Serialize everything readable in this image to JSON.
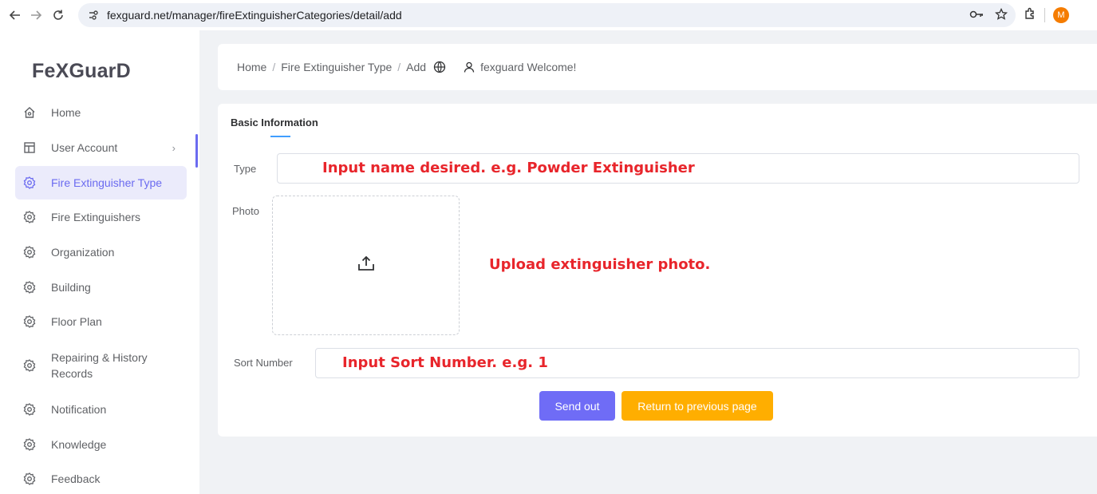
{
  "browser": {
    "url": "fexguard.net/manager/fireExtinguisherCategories/detail/add",
    "profile_initial": "M"
  },
  "sidebar": {
    "logo": "FeXGuarD",
    "items": [
      {
        "label": "Home",
        "icon": "home-icon"
      },
      {
        "label": "User Account",
        "icon": "layout-icon",
        "has_arrow": true
      },
      {
        "label": "Fire Extinguisher Type",
        "icon": "gear-icon",
        "active": true
      },
      {
        "label": "Fire Extinguishers",
        "icon": "gear-icon"
      },
      {
        "label": "Organization",
        "icon": "gear-icon"
      },
      {
        "label": "Building",
        "icon": "gear-icon"
      },
      {
        "label": "Floor Plan",
        "icon": "gear-icon"
      },
      {
        "label": "Repairing & History Records",
        "line1": "Repairing & History",
        "line2": "Records",
        "icon": "gear-icon"
      },
      {
        "label": "Notification",
        "icon": "gear-icon"
      },
      {
        "label": "Knowledge",
        "icon": "gear-icon"
      },
      {
        "label": "Feedback",
        "icon": "gear-icon"
      }
    ],
    "arrow": "›"
  },
  "header": {
    "breadcrumb": [
      "Home",
      "Fire Extinguisher Type",
      "Add"
    ],
    "separator": "/",
    "welcome": "fexguard Welcome!"
  },
  "form": {
    "tab": "Basic Information",
    "type_label": "Type",
    "photo_label": "Photo",
    "sort_label": "Sort Number",
    "type_annotation": "Input name desired.  e.g. Powder Extinguisher",
    "photo_annotation": "Upload extinguisher photo.",
    "sort_annotation": "Input Sort Number.  e.g. 1",
    "send_button": "Send out",
    "return_button": "Return to previous page"
  },
  "colors": {
    "accent": "#6b6bf0",
    "send_button": "#6f6cf6",
    "return_button": "#ffae00",
    "annotation": "#e8252b"
  }
}
